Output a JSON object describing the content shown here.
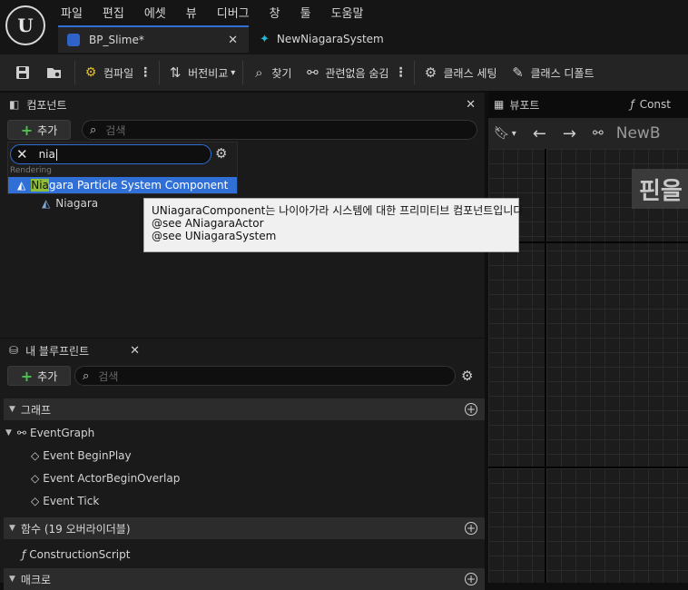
{
  "app": {
    "logo": "U",
    "menu": [
      "파일",
      "편집",
      "에셋",
      "뷰",
      "디버그",
      "창",
      "툴",
      "도움말"
    ],
    "tabs": [
      {
        "label": "BP_Slime*",
        "close": "✕",
        "icon_color": "#2f63c8"
      },
      {
        "label": "NewNiagaraSystem",
        "icon_color": "#20b8d8"
      }
    ]
  },
  "toolbar": {
    "compile": "컴파일",
    "diff": "버전비교",
    "find": "찾기",
    "hide_unrelated": "관련없음 숨김",
    "class_settings": "클래스 세팅",
    "class_defaults": "클래스 디폴트"
  },
  "components_panel": {
    "title": "컴포넌트",
    "close": "✕",
    "add_label": "추가",
    "search_placeholder": "검색",
    "popup_search_value": "nia",
    "category": "Rendering",
    "result_highlight": "Nia",
    "result_rest": "gara Particle System Component",
    "tree_item": "Niagara"
  },
  "tooltip": {
    "line1": "UNiagaraComponent는 나이아가라 시스템에 대한 프리미티브 컴포넌트입니다.",
    "line2": "@see ANiagaraActor",
    "line3": "@see UNiagaraSystem"
  },
  "viewport": {
    "tab_label": "뷰포트",
    "construction_tab": "Const",
    "breadcrumb": "NewB",
    "overlay_text": "핀을"
  },
  "blueprint_panel": {
    "title": "내 블루프린트",
    "close": "✕",
    "add_label": "추가",
    "search_placeholder": "검색",
    "sections": {
      "graph": "그래프",
      "functions": "함수 (19 오버라이더블)",
      "macros": "매크로"
    },
    "event_graph": "EventGraph",
    "events": [
      "Event BeginPlay",
      "Event ActorBeginOverlap",
      "Event Tick"
    ],
    "construction_script": "ConstructionScript"
  },
  "colors": {
    "accent_blue": "#2f6fd6",
    "selection_blue": "#2f6fd6",
    "highlight_match": "#8fbf3a",
    "add_plus_green": "#4cc34c"
  }
}
